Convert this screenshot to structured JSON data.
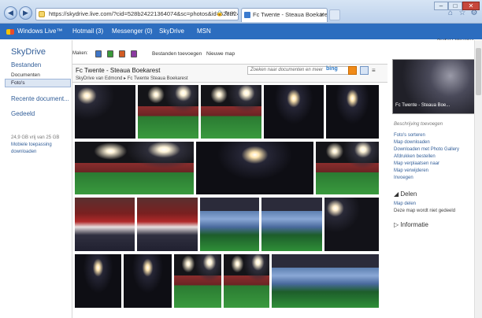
{
  "browser": {
    "url": "https://skydrive.live.com/?cid=528b24221364074&sc=photos&id=528B24221364074!157",
    "tab_title": "Fc Twente - Steaua Boekarest",
    "window_buttons": {
      "min": "–",
      "max": "□",
      "close": "✕"
    },
    "toolbar_icons": [
      "home-icon",
      "star-icon",
      "gear-icon"
    ]
  },
  "livebar": {
    "brand": "Windows Live™",
    "items": [
      "Hotmail (3)",
      "Messenger (0)",
      "SkyDrive",
      "MSN"
    ],
    "profile": "Profiel | Afmelden"
  },
  "sidebar": {
    "title": "SkyDrive",
    "bestanden": "Bestanden",
    "documenten": "Documenten",
    "fotos": "Foto's",
    "recente": "Recente document...",
    "gedeeld": "Gedeeld",
    "storage": "24,9 GB vrij van 25 GB",
    "mobile1": "Mobiele toepassing",
    "mobile2": "downloaden"
  },
  "toolbar": {
    "maken_label": "Maken:",
    "add_files": "Bestanden toevoegen",
    "new_folder": "Nieuwe map"
  },
  "album": {
    "title": "Fc Twente - Steaua Boekarest",
    "crumb1": "SkyDrive van Edmond",
    "crumb2": "Fc Twente",
    "crumb3": "Steaua Boekarest",
    "search_placeholder": "Zoeken naar documenten en meer",
    "search_engine": "bing"
  },
  "details": {
    "thumb_caption": "Fc Twente - Steaua Boe...",
    "description": "Beschrijving toevoegen",
    "actions": [
      "Foto's sorteren",
      "Map downloaden",
      "Downloaden met Photo Gallery",
      "Afdrukken bestellen",
      "Map verplaatsen naar",
      "Map verwijderen",
      "Invoegen"
    ],
    "share_heading": "Delen",
    "share_link": "Map delen",
    "share_text": "Deze map wordt niet gedeeld",
    "info_heading": "Informatie"
  },
  "colors": {
    "live_blue": "#2c6dbf",
    "link": "#335f99",
    "accent_orange": "#f08a18"
  }
}
